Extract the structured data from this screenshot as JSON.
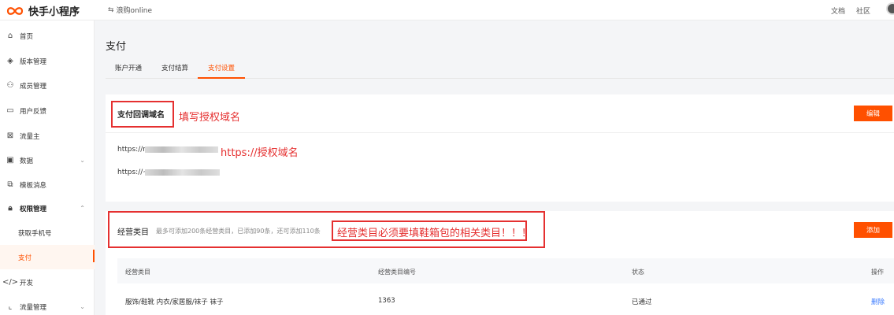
{
  "header": {
    "app_name": "快手小程序",
    "account": "浪购online",
    "links": [
      "文档",
      "社区"
    ]
  },
  "sidebar": {
    "items": [
      {
        "label": "首页",
        "icon": "home-icon"
      },
      {
        "label": "版本管理",
        "icon": "layers-icon"
      },
      {
        "label": "成员管理",
        "icon": "members-icon"
      },
      {
        "label": "用户反馈",
        "icon": "feedback-icon"
      },
      {
        "label": "流量主",
        "icon": "traffic-icon"
      },
      {
        "label": "数据",
        "icon": "data-icon"
      },
      {
        "label": "模板消息",
        "icon": "template-icon"
      },
      {
        "label": "权限管理",
        "icon": "lock-icon"
      },
      {
        "label": "获取手机号"
      },
      {
        "label": "支付"
      },
      {
        "label": "开发",
        "icon": "code-icon"
      },
      {
        "label": "流量管理",
        "icon": "chart-icon"
      }
    ]
  },
  "page": {
    "title": "支付",
    "tabs": [
      "账户开通",
      "支付结算",
      "支付设置"
    ],
    "active_tab": "支付设置"
  },
  "callback": {
    "title": "支付回调域名",
    "annotation": "填写授权域名",
    "edit_label": "编辑",
    "url1_prefix": "https://r",
    "url1_annotation": "https://授权域名",
    "url2_prefix": "https://~"
  },
  "business": {
    "title": "经营类目",
    "hint": "最多可添加200条经营类目，已添加90条，还可添加110条",
    "annotation": "经营类目必须要填鞋箱包的相关类目！！！",
    "add_label": "添加",
    "columns": [
      "经营类目",
      "经营类目编号",
      "状态",
      "操作"
    ],
    "rows": [
      {
        "category": "服饰/鞋靴 内衣/家居服/袜子 袜子",
        "code": "1363",
        "status": "已通过",
        "action": "删除"
      }
    ]
  },
  "colors": {
    "accent": "#ff5000",
    "annotation": "#e53030",
    "link": "#3a7bff"
  }
}
